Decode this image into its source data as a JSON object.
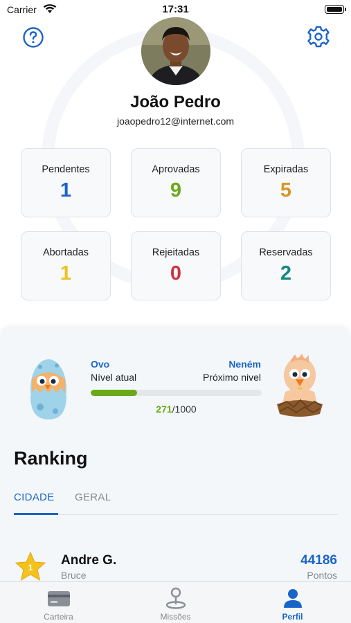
{
  "status_bar": {
    "carrier": "Carrier",
    "time": "17:31"
  },
  "profile": {
    "name": "João Pedro",
    "email": "joaopedro12@internet.com"
  },
  "stats": [
    {
      "label": "Pendentes",
      "value": "1",
      "color": "#1a64c8"
    },
    {
      "label": "Aprovadas",
      "value": "9",
      "color": "#6aa918"
    },
    {
      "label": "Expiradas",
      "value": "5",
      "color": "#d6972a"
    },
    {
      "label": "Abortadas",
      "value": "1",
      "color": "#f0c020"
    },
    {
      "label": "Rejeitadas",
      "value": "0",
      "color": "#cf3340"
    },
    {
      "label": "Reservadas",
      "value": "2",
      "color": "#138a80"
    }
  ],
  "level": {
    "current_name": "Ovo",
    "current_label": "Nível atual",
    "next_name": "Neném",
    "next_label": "Próximo nivel",
    "progress_current": "271",
    "progress_total": "/1000",
    "progress_fraction": 0.271
  },
  "ranking": {
    "title": "Ranking",
    "tabs": [
      "CIDADE",
      "GERAL"
    ],
    "active_tab": "CIDADE",
    "entries": [
      {
        "position": "1",
        "name": "Andre G.",
        "subtitle": "Bruce",
        "points": "44186",
        "points_label": "Pontos"
      }
    ]
  },
  "tab_bar": {
    "items": [
      {
        "label": "Carteira",
        "icon": "wallet-card-icon"
      },
      {
        "label": "Missões",
        "icon": "map-pin-icon"
      },
      {
        "label": "Perfil",
        "icon": "person-icon"
      }
    ],
    "active": "Perfil"
  },
  "colors": {
    "accent": "#1a64c8",
    "progress": "#6aa918"
  }
}
